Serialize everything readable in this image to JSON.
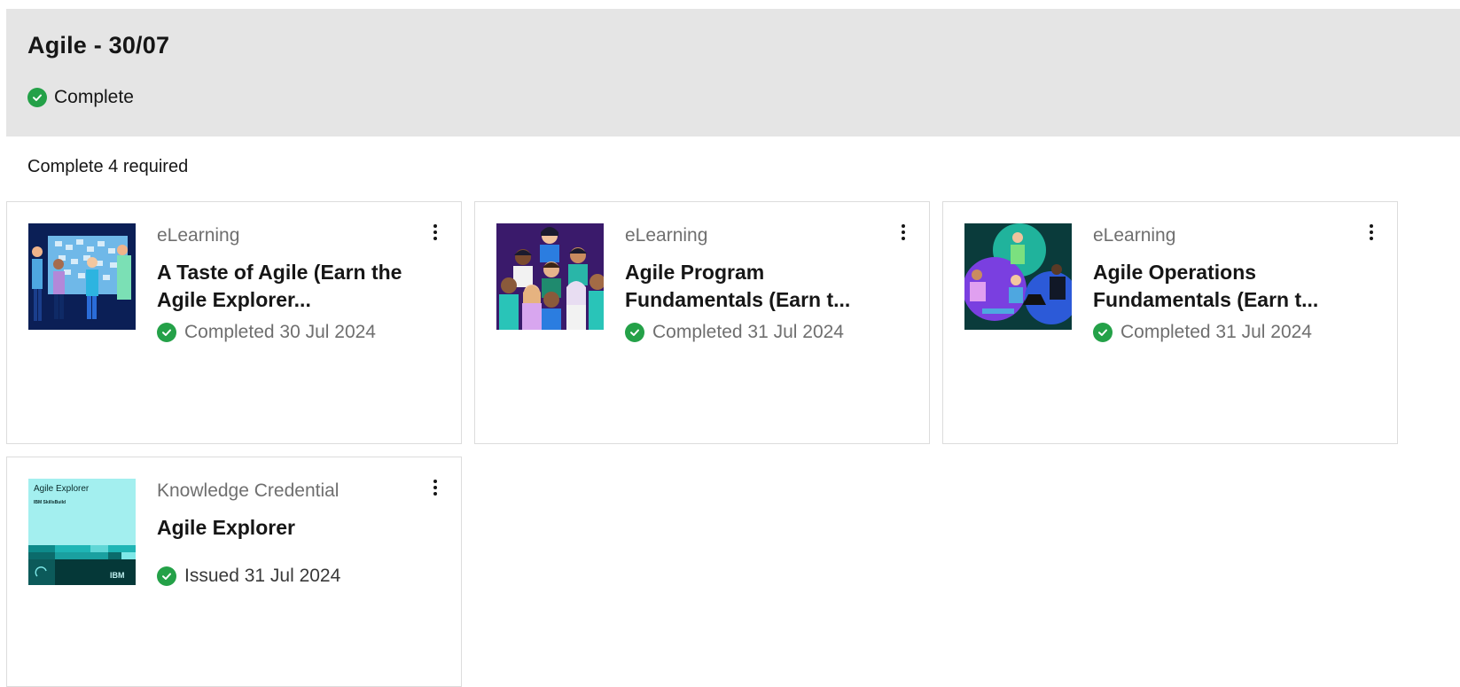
{
  "header": {
    "title": "Agile - 30/07",
    "status": "Complete",
    "status_color": "#24a148",
    "background": "#e5e5e5"
  },
  "requirement_text": "Complete 4 required",
  "cards": [
    {
      "type": "eLearning",
      "title": "A Taste of Agile (Earn the Agile Explorer...",
      "status": "Completed 30 Jul 2024",
      "thumbnail": "team-at-board-illustration",
      "menu_icon": "overflow-menu-icon"
    },
    {
      "type": "eLearning",
      "title": "Agile Program Fundamentals (Earn t...",
      "status": "Completed 31 Jul 2024",
      "thumbnail": "crowd-of-people-illustration",
      "menu_icon": "overflow-menu-icon"
    },
    {
      "type": "eLearning",
      "title": "Agile Operations Fundamentals (Earn t...",
      "status": "Completed 31 Jul 2024",
      "thumbnail": "people-with-laptops-illustration",
      "menu_icon": "overflow-menu-icon"
    },
    {
      "type": "Knowledge Credential",
      "title": "Agile Explorer",
      "status": "Issued 31 Jul 2024",
      "thumbnail": "agile-explorer-badge",
      "badge_title": "Agile Explorer",
      "badge_subtitle": "IBM SkillsBuild",
      "badge_brand": "IBM",
      "menu_icon": "overflow-menu-icon"
    }
  ]
}
